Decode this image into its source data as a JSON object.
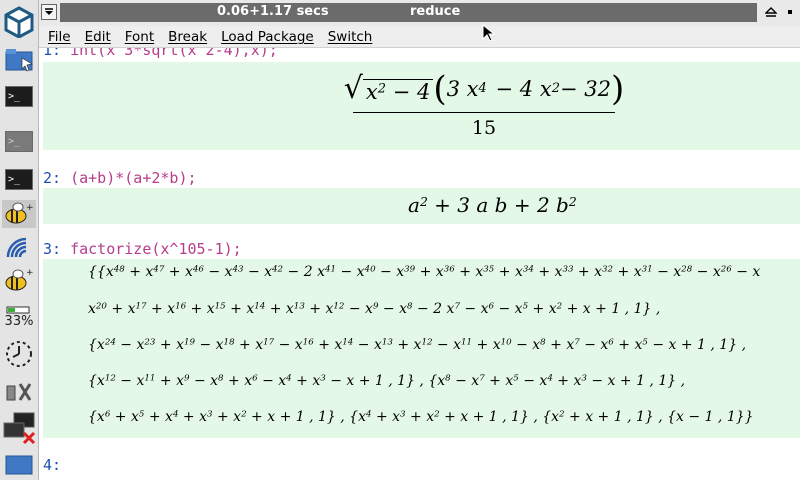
{
  "titlebar": {
    "timing": "0.06+1.17 secs",
    "title": "reduce"
  },
  "menubar": [
    "File",
    "Edit",
    "Font",
    "Break",
    "Load Package",
    "Switch"
  ],
  "dock": {
    "items": [
      "files-icon",
      "terminal-icon",
      "terminal-icon",
      "terminal-icon",
      "bee-icon",
      "wifi-icon",
      "bee-icon",
      "battery-icon",
      "clock-icon",
      "settings-icon",
      "network-disconnected-icon",
      "desktop-icon"
    ],
    "battery_label": "33%"
  },
  "session": {
    "entries": [
      {
        "prompt": "1:",
        "command": "int(x^3*sqrt(x^2-4),x);",
        "result_denominator": "15"
      },
      {
        "prompt": "2:",
        "command": "(a+b)*(a+2*b);"
      },
      {
        "prompt": "3:",
        "command": "factorize(x^105-1);"
      },
      {
        "prompt": "4:",
        "command": ""
      }
    ]
  }
}
